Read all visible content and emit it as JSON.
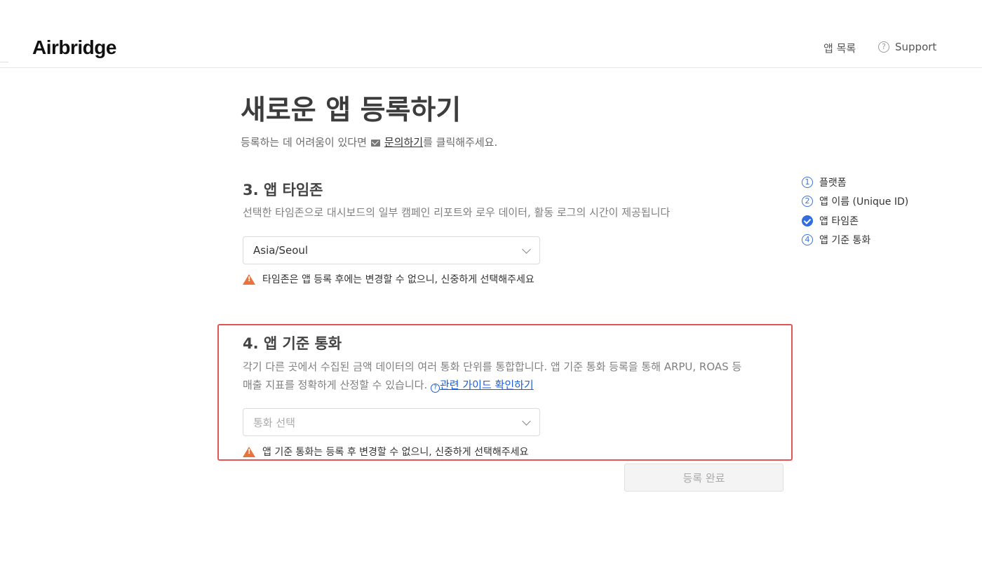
{
  "header": {
    "logo": "Airbridge",
    "nav_apps": "앱 목록",
    "nav_support": "Support"
  },
  "page": {
    "title": "새로운 앱 등록하기",
    "subtitle_before": "등록하는 데 어려움이 있다면",
    "subtitle_link": "문의하기",
    "subtitle_after": "를 클릭해주세요."
  },
  "timezone": {
    "title": "3. 앱 타임존",
    "description": "선택한 타임존으로 대시보드의 일부 캠페인 리포트와 로우 데이터, 활동 로그의 시간이 제공됩니다",
    "selected": "Asia/Seoul",
    "warning": "타임존은 앱 등록 후에는 변경할 수 없으니, 신중하게 선택해주세요"
  },
  "currency": {
    "title": "4. 앱 기준 통화",
    "description_line1": "각기 다른 곳에서 수집된 금액 데이터의 여러 통화 단위를 통합합니다. 앱 기준 통화 등록을 통해 ARPU, ROAS 등",
    "description_line2": "매출 지표를 정확하게 산정할 수 있습니다.",
    "guide_link": "관련 가이드 확인하기",
    "placeholder": "통화 선택",
    "warning": "앱 기준 통화는 등록 후 변경할 수 없으니, 신중하게 선택해주세요"
  },
  "submit_label": "등록 완료",
  "steps": [
    {
      "num": "1",
      "label": "플랫폼",
      "done": false
    },
    {
      "num": "2",
      "label": "앱 이름 (Unique ID)",
      "done": false
    },
    {
      "num": "3",
      "label": "앱 타임존",
      "done": true
    },
    {
      "num": "4",
      "label": "앱 기준 통화",
      "done": false
    }
  ],
  "colors": {
    "accent": "#2f6de0",
    "warning": "#e8743b",
    "highlight_border": "#e05555",
    "link": "#1a5ce0"
  }
}
